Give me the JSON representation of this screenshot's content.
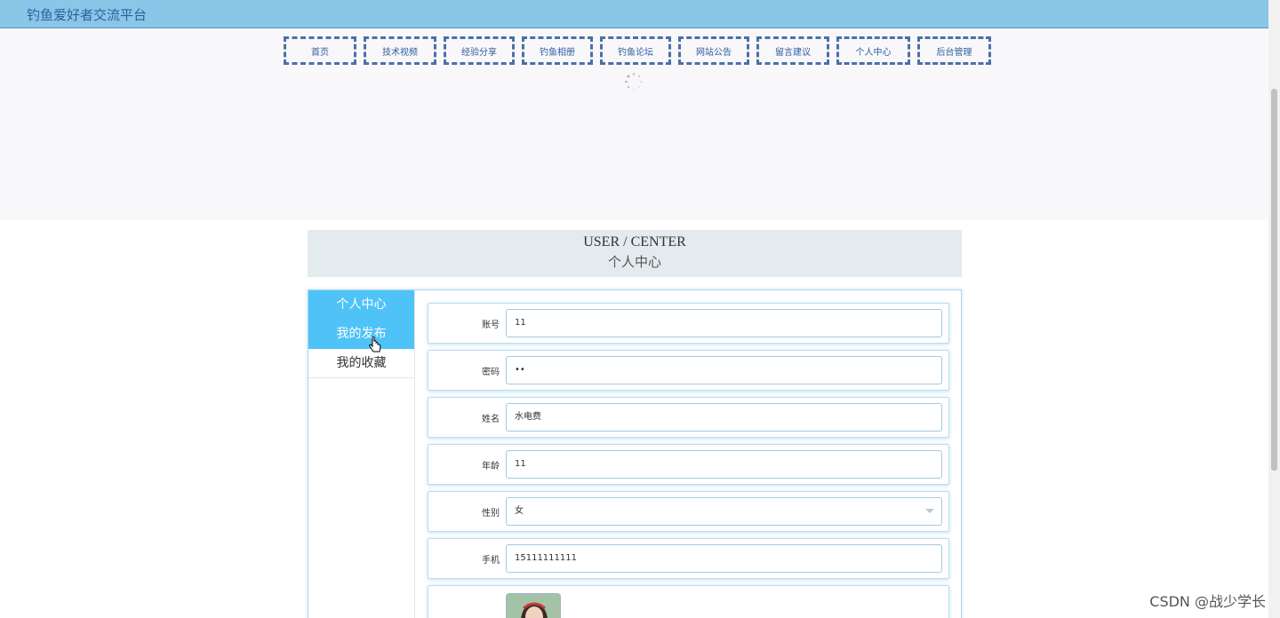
{
  "header": {
    "site_title": "钓鱼爱好者交流平台"
  },
  "nav": {
    "items": [
      {
        "label": "首页"
      },
      {
        "label": "技术视频"
      },
      {
        "label": "经验分享"
      },
      {
        "label": "钓鱼相册"
      },
      {
        "label": "钓鱼论坛"
      },
      {
        "label": "网站公告"
      },
      {
        "label": "留言建议"
      },
      {
        "label": "个人中心"
      },
      {
        "label": "后台管理"
      }
    ]
  },
  "section_title": {
    "en": "USER / CENTER",
    "cn": "个人中心"
  },
  "sidebar": {
    "items": [
      {
        "label": "个人中心",
        "active": true
      },
      {
        "label": "我的发布",
        "active": true
      },
      {
        "label": "我的收藏",
        "active": false
      }
    ]
  },
  "form": {
    "account": {
      "label": "账号",
      "value": "11"
    },
    "password": {
      "label": "密码",
      "value": "••"
    },
    "name": {
      "label": "姓名",
      "value": "水电费"
    },
    "age": {
      "label": "年龄",
      "value": "11"
    },
    "gender": {
      "label": "性别",
      "value": "女"
    },
    "phone": {
      "label": "手机",
      "value": "15111111111"
    }
  },
  "watermark": "CSDN @战少学长",
  "colors": {
    "topbar": "#89c6e8",
    "accent": "#4fc3f7",
    "nav_border": "#4d70a3"
  }
}
